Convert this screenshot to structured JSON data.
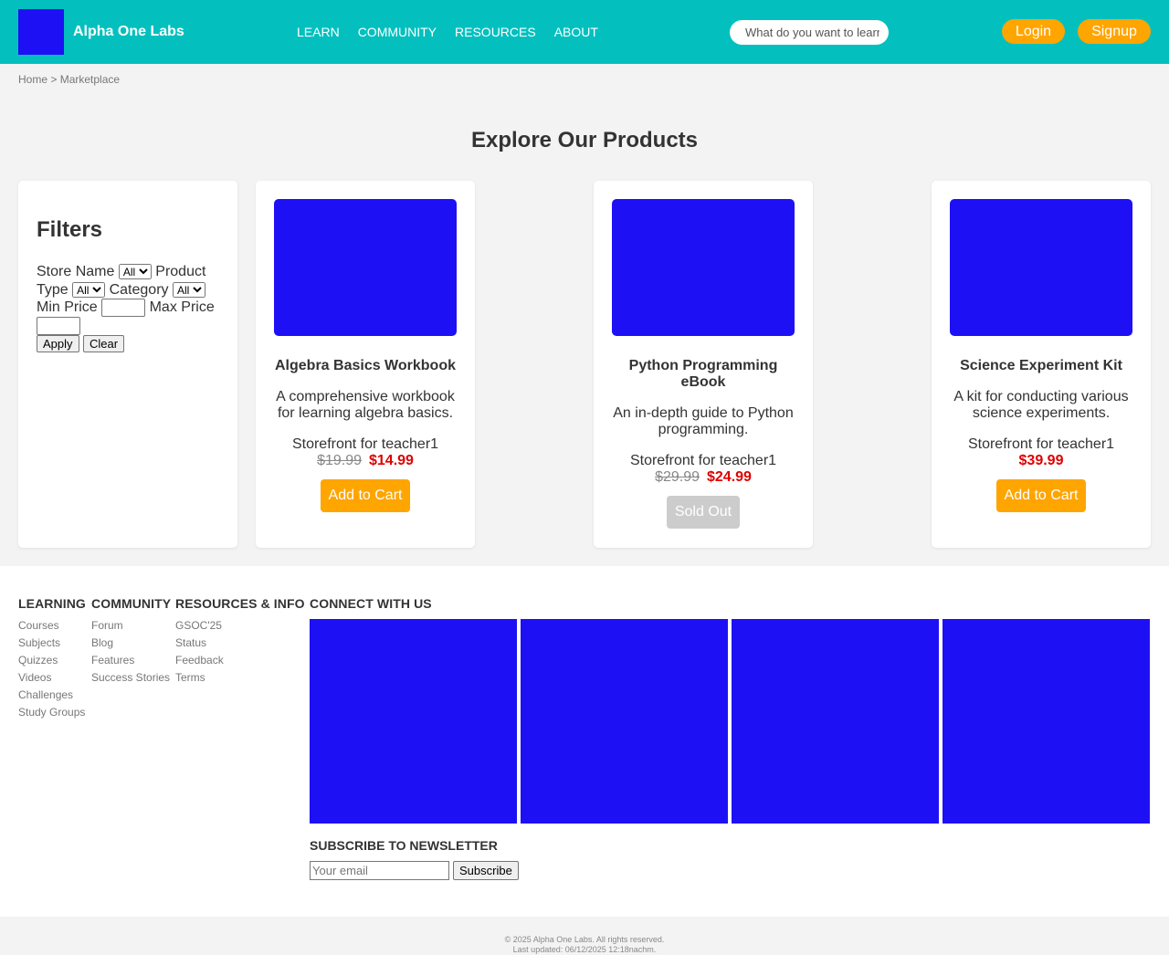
{
  "header": {
    "brand": "Alpha One Labs",
    "logo_color": "#1e10f5",
    "nav": [
      "LEARN",
      "COMMUNITY",
      "RESOURCES",
      "ABOUT"
    ],
    "search_placeholder": "What do you want to learn?",
    "login_label": "Login",
    "signup_label": "Signup"
  },
  "breadcrumb": {
    "home": "Home",
    "separator": " > ",
    "current": "Marketplace"
  },
  "page_title": "Explore Our Products",
  "filters": {
    "title": "Filters",
    "store_name_label": "Store Name",
    "product_type_label": "Product Type",
    "category_label": "Category",
    "min_price_label": "Min Price",
    "max_price_label": "Max Price",
    "select_value": "All",
    "apply_label": "Apply",
    "clear_label": "Clear"
  },
  "products": [
    {
      "name": "Algebra Basics Workbook",
      "description": "A comprehensive workbook for learning algebra basics.",
      "store": "Storefront for teacher1",
      "old_price": "$19.99",
      "price": "$14.99",
      "action": "Add to Cart"
    },
    {
      "name": "Python Programming eBook",
      "description": "An in-depth guide to Python programming.",
      "store": "Storefront for teacher1",
      "old_price": "$29.99",
      "price": "$24.99",
      "action": "Sold Out"
    },
    {
      "name": "Science Experiment Kit",
      "description": "A kit for conducting various science experiments.",
      "store": "Storefront for teacher1",
      "price": "$39.99",
      "action": "Add to Cart"
    }
  ],
  "footer": {
    "learning": {
      "title": "LEARNING",
      "items": [
        "Courses",
        "Subjects",
        "Quizzes",
        "Videos",
        "Challenges",
        "Study Groups"
      ]
    },
    "community": {
      "title": "COMMUNITY",
      "items": [
        "Forum",
        "Blog",
        "Features",
        "Success Stories"
      ]
    },
    "resources": {
      "title": "RESOURCES & INFO",
      "items": [
        "GSOC'25",
        "Status",
        "Feedback",
        "Terms"
      ]
    },
    "connect_title": "CONNECT WITH US",
    "newsletter_title": "SUBSCRIBE TO NEWSLETTER",
    "email_placeholder": "Your email",
    "subscribe_label": "Subscribe"
  },
  "copyright": "© 2025 Alpha One Labs. All rights reserved.",
  "last_updated": "Last updated: 06/12/2025 12:18nachm.",
  "colors": {
    "header": "#03c0bf",
    "accent": "#ffa500",
    "sale": "#e00000",
    "placeholder_image": "#1e10f5"
  }
}
